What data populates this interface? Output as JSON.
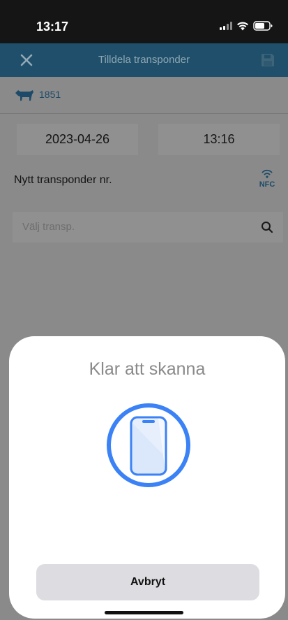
{
  "status": {
    "time": "13:17"
  },
  "nav": {
    "title": "Tilldela transponder"
  },
  "animal": {
    "id": "1851"
  },
  "form": {
    "date": "2023-04-26",
    "time": "13:16",
    "transponder_label": "Nytt transponder nr.",
    "nfc_label": "NFC",
    "search_placeholder": "Välj transp."
  },
  "sheet": {
    "title": "Klar att skanna",
    "cancel_label": "Avbryt"
  },
  "colors": {
    "nav_bar": "#1f4f6a",
    "accent_blue": "#3b82f6",
    "sheet_bg": "#ffffff",
    "cancel_bg": "#dcdce1"
  },
  "icons": {
    "close": "close-icon",
    "save": "save-icon",
    "cow": "cow-icon",
    "nfc": "nfc-icon",
    "search": "search-icon",
    "scan": "phone-scan-icon"
  }
}
